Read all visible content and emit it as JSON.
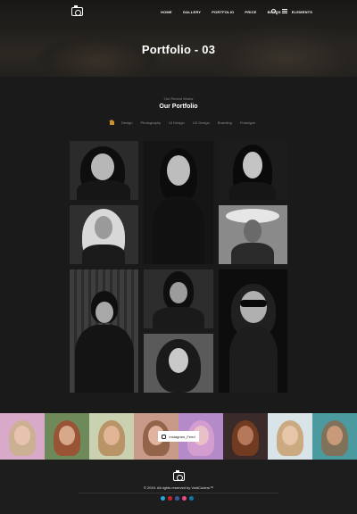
{
  "nav": {
    "items": [
      "HOME",
      "GALLERY",
      "PORTFOLIO",
      "PRICE",
      "BLOGS",
      "ELEMENTS"
    ]
  },
  "hero": {
    "title": "Portfolio - 03"
  },
  "section": {
    "subtitle": "Our Recent Works",
    "title": "Our Portfolio",
    "filters": [
      "Design",
      "Photography",
      "UI Design",
      "UX Design",
      "Branding",
      "Prototype"
    ]
  },
  "instagram": {
    "label": "Instagram_Feed"
  },
  "footer": {
    "copyright": "© 2019. All rights reserved by VoidCoders™"
  },
  "icons": [
    "camera-logo-icon",
    "search-icon",
    "menu-icon",
    "home-icon",
    "instagram-icon",
    "twitter-icon",
    "pinterest-icon",
    "facebook-icon",
    "dribbble-icon",
    "linkedin-icon"
  ],
  "colors": {
    "accent": "#c8902e",
    "background": "#1a1a1a",
    "footer": "#1d1d1d"
  }
}
